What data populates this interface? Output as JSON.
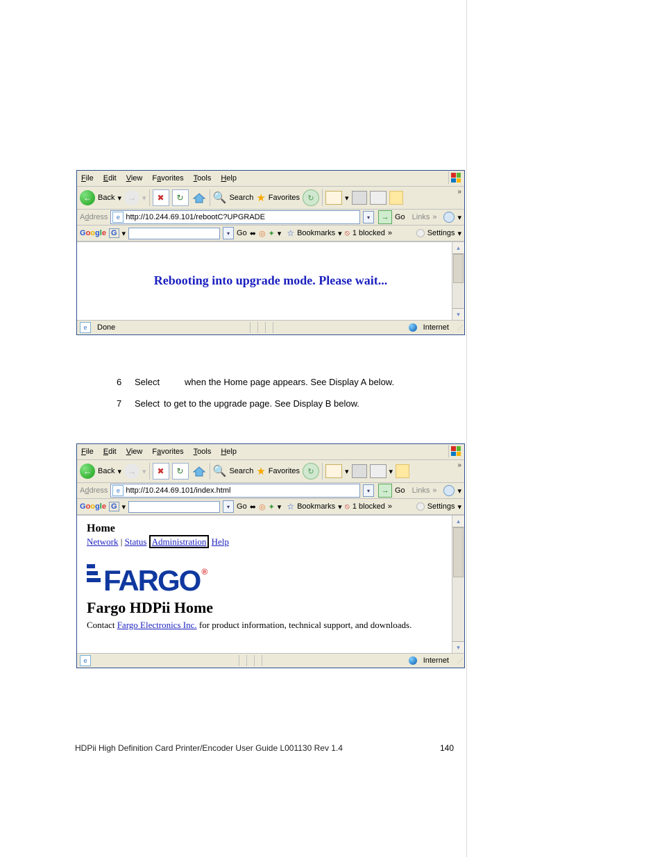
{
  "ie": {
    "menu": {
      "file": "File",
      "edit": "Edit",
      "view": "View",
      "favorites": "Favorites",
      "tools": "Tools",
      "help": "Help"
    },
    "toolbar": {
      "back": "Back",
      "search": "Search",
      "favorites": "Favorites"
    },
    "address_label": "Address",
    "go": "Go",
    "links": "Links",
    "status_done": "Done",
    "status_zone": "Internet"
  },
  "google_bar": {
    "go": "Go",
    "bookmarks": "Bookmarks",
    "blocked": "1 blocked",
    "settings": "Settings"
  },
  "win1": {
    "url": "http://10.244.69.101/rebootC?UPGRADE",
    "message": "Rebooting into upgrade mode. Please wait..."
  },
  "steps": [
    {
      "n": "6",
      "action": "Select",
      "rest": "when the Home page appears. See Display A below."
    },
    {
      "n": "7",
      "action": "Select",
      "rest": "to get to the upgrade page. See Display B below."
    }
  ],
  "win2": {
    "url": "http://10.244.69.101/index.html",
    "home_heading": "Home",
    "nav": {
      "network": "Network",
      "status": "Status",
      "admin": "Administration",
      "help": "Help"
    },
    "logo_text": "FARGO",
    "title": "Fargo HDPii Home",
    "contact_prefix": "Contact ",
    "contact_link": "Fargo Electronics Inc.",
    "contact_suffix": " for product information, technical support, and downloads."
  },
  "footer": "HDPii High Definition Card Printer/Encoder User Guide    L001130 Rev 1.4",
  "page_number": "140"
}
